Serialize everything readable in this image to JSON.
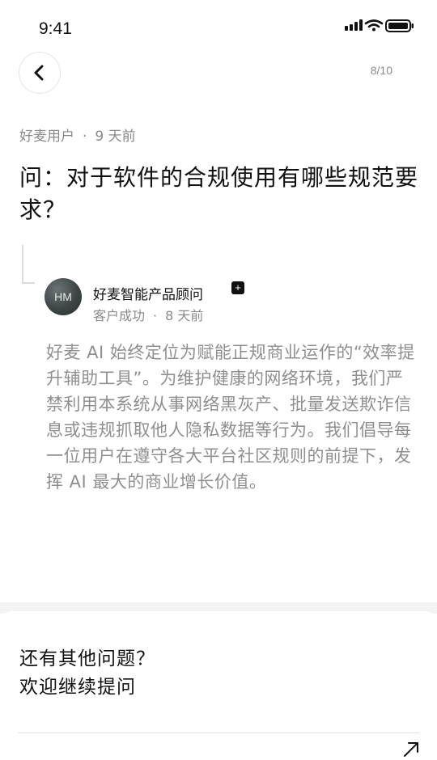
{
  "status_bar": {
    "time": "9:41"
  },
  "header": {
    "back_icon": "chevron-left-icon",
    "page_indicator": "8/10"
  },
  "question": {
    "author": "好麦用户",
    "separator": "·",
    "time_ago": "9 天前",
    "title": "问：对于软件的合规使用有哪些规范要求？"
  },
  "answer": {
    "avatar_initials": "HM",
    "author": "好麦智能产品顾问",
    "badge": "+",
    "role": "客户成功",
    "separator": "·",
    "time_ago": "8 天前",
    "body": "好麦 AI 始终定位为赋能正规商业运作的“效率提升辅助工具”。为维护健康的网络环境，我们严禁利用本系统从事网络黑灰产、批量发送欺诈信息或违规抓取他人隐私数据等行为。我们倡导每一位用户在遵守各大平台社区规则的前提下，发挥 AI 最大的商业增长价值。"
  },
  "footer": {
    "prompt_line1": "还有其他问题？",
    "prompt_line2": "欢迎继续提问",
    "action_icon": "arrow-up-right-icon"
  },
  "colors": {
    "text_primary": "#111111",
    "text_secondary": "#8a8a8a",
    "answer_text": "#8f8f8f",
    "divider": "#f3f3f3"
  }
}
